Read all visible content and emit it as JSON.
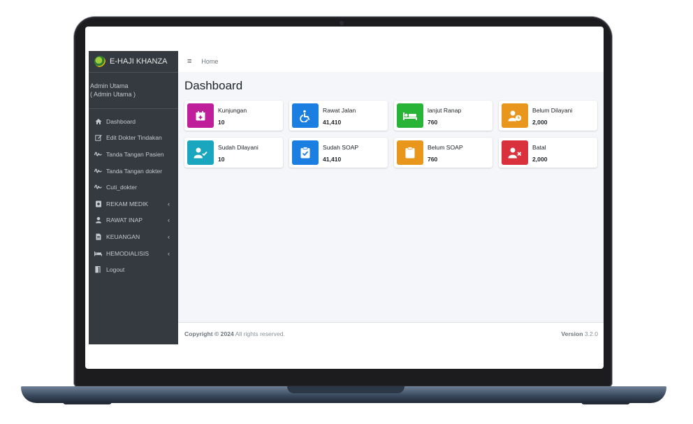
{
  "app": {
    "brand": "E-HAJI KHANZA"
  },
  "user": {
    "name": "Admin Utama",
    "role": "( Admin Utama )"
  },
  "sidebar": {
    "items": [
      {
        "label": "Dashboard",
        "icon": "home-icon"
      },
      {
        "label": "Edit Dokter Tindakan",
        "icon": "edit-icon"
      },
      {
        "label": "Tanda Tangan Pasien",
        "icon": "signature-icon"
      },
      {
        "label": "Tanda Tangan dokter",
        "icon": "signature-icon"
      },
      {
        "label": "Cuti_dokter",
        "icon": "signature-icon"
      },
      {
        "label": "REKAM MEDIK",
        "icon": "medical-record-icon",
        "has_submenu": true
      },
      {
        "label": "RAWAT INAP",
        "icon": "patient-icon",
        "has_submenu": true
      },
      {
        "label": "KEUANGAN",
        "icon": "invoice-icon",
        "has_submenu": true
      },
      {
        "label": "HEMODIALISIS",
        "icon": "bed-icon",
        "has_submenu": true
      },
      {
        "label": "Logout",
        "icon": "door-icon"
      }
    ]
  },
  "topbar": {
    "breadcrumb": "Home",
    "menu_icon": "hamburger-icon"
  },
  "page": {
    "title": "Dashboard"
  },
  "cards": [
    {
      "label": "Kunjungan",
      "value": "10",
      "color": "#c01f9b",
      "icon": "calendar-plus-icon"
    },
    {
      "label": "Rawat Jalan",
      "value": "41,410",
      "color": "#1a7fe0",
      "icon": "wheelchair-icon"
    },
    {
      "label": "lanjut Ranap",
      "value": "760",
      "color": "#28b436",
      "icon": "bed-icon"
    },
    {
      "label": "Belum Dilayani",
      "value": "2,000",
      "color": "#e8961c",
      "icon": "user-clock-icon"
    },
    {
      "label": "Sudah Dilayani",
      "value": "10",
      "color": "#1ba6bf",
      "icon": "user-check-icon"
    },
    {
      "label": "Sudah SOAP",
      "value": "41,410",
      "color": "#1a7fe0",
      "icon": "clipboard-check-icon"
    },
    {
      "label": "Belum SOAP",
      "value": "760",
      "color": "#e8961c",
      "icon": "clipboard-icon"
    },
    {
      "label": "Batal",
      "value": "2,000",
      "color": "#d9323d",
      "icon": "user-times-icon"
    }
  ],
  "footer": {
    "copyright_strong": "Copyright © 2024",
    "copyright_rest": " All rights reserved.",
    "version_label": "Version",
    "version_value": " 3.2.0"
  }
}
